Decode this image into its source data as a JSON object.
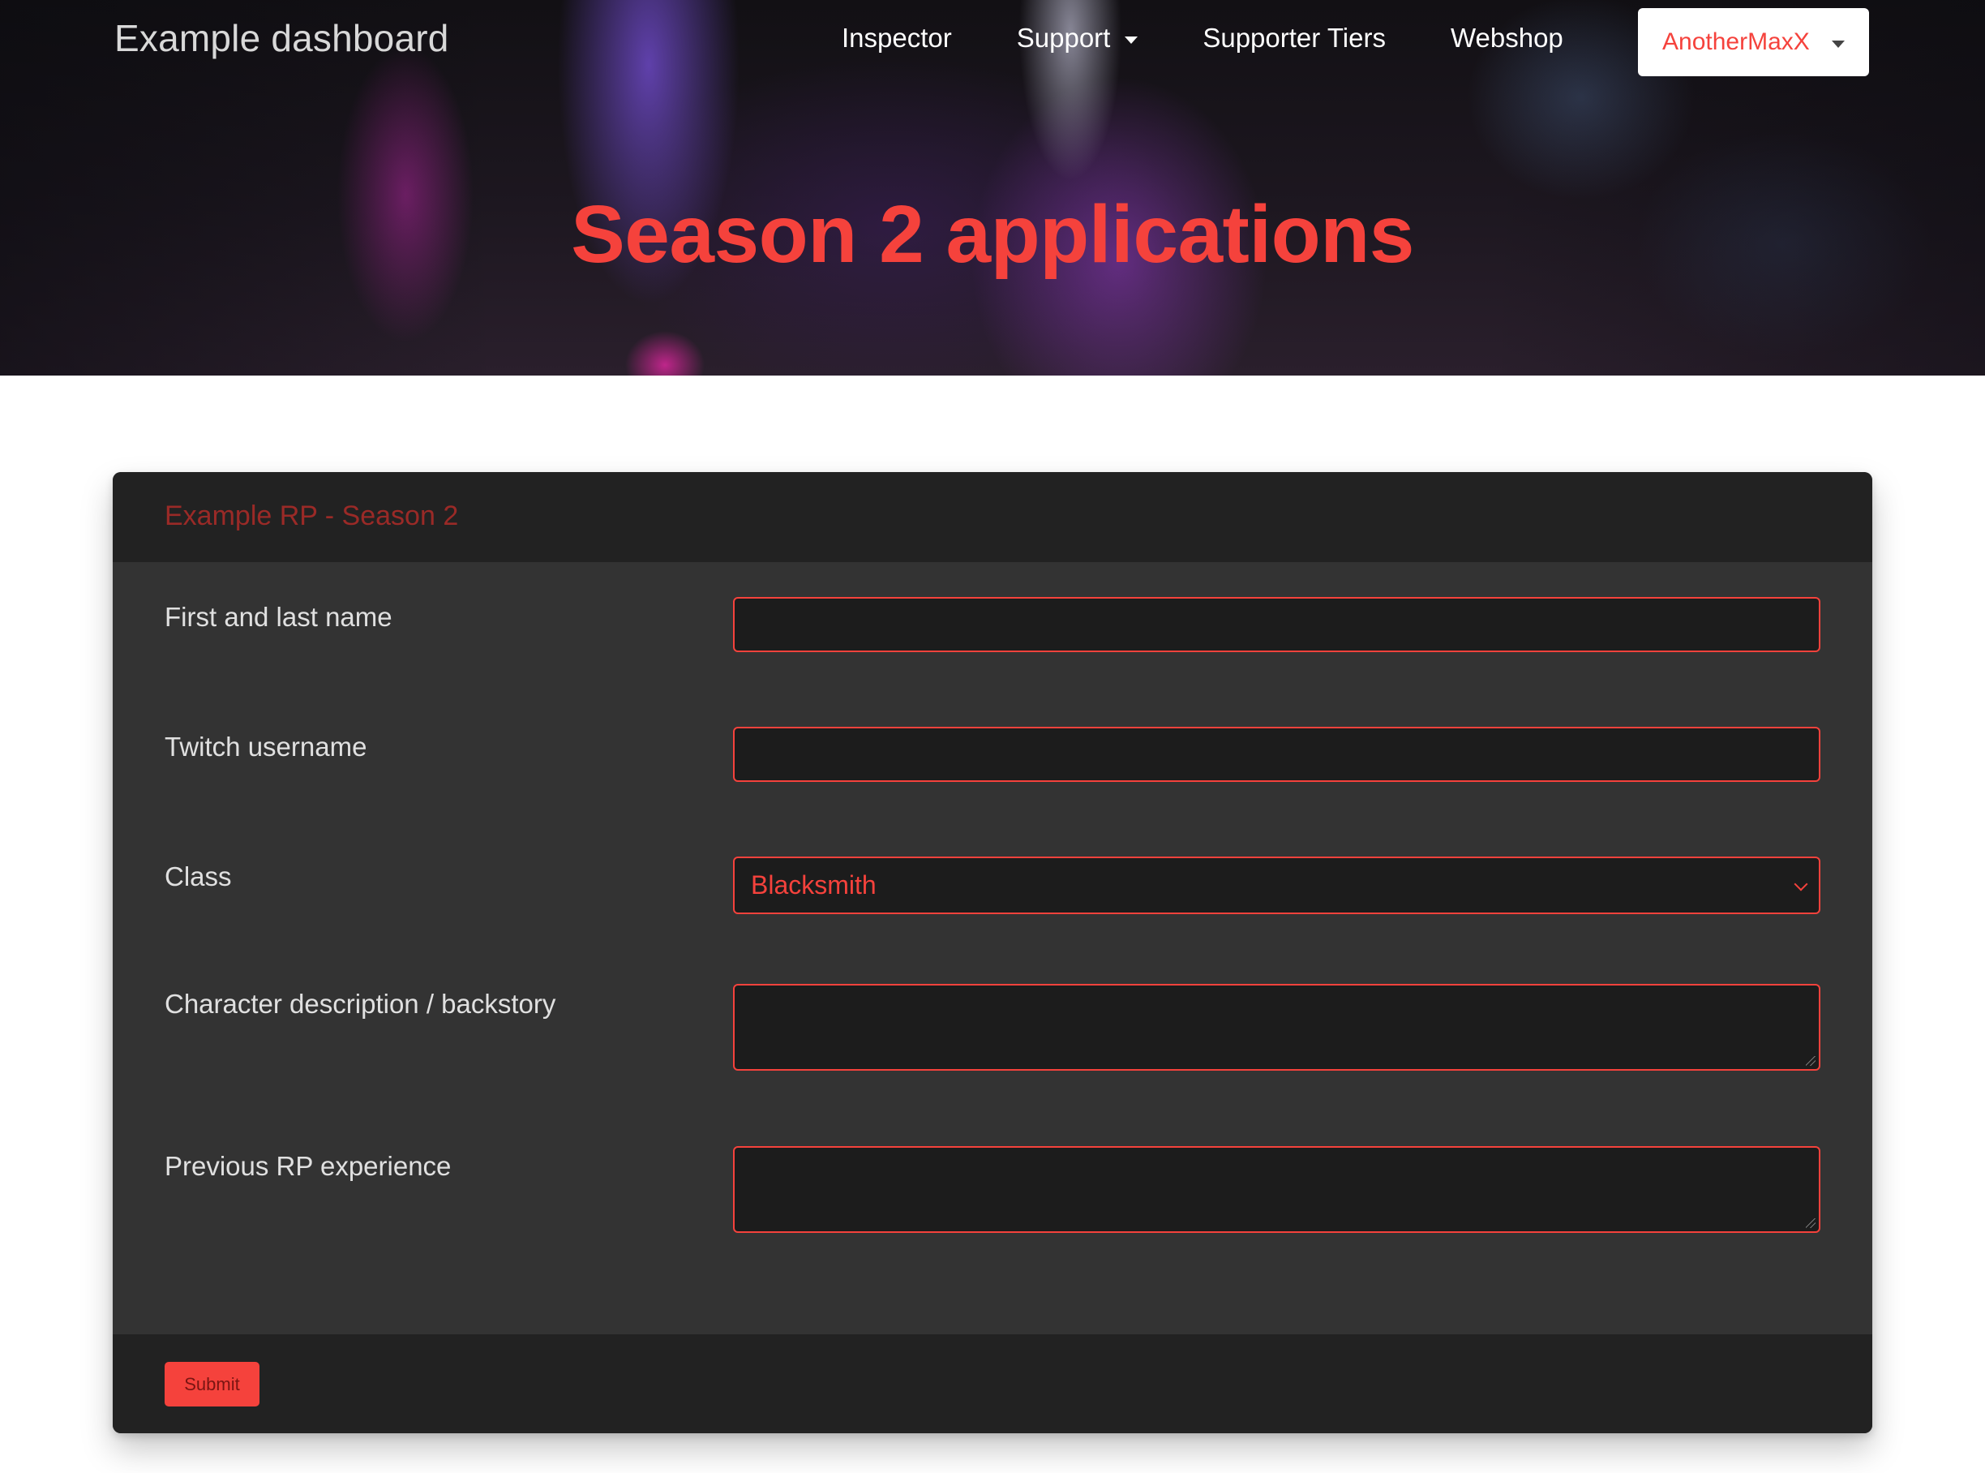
{
  "header": {
    "brand": "Example dashboard",
    "nav": {
      "inspector": "Inspector",
      "support": "Support",
      "supporter_tiers": "Supporter Tiers",
      "webshop": "Webshop"
    },
    "user_menu": "AnotherMaxX"
  },
  "hero": {
    "title": "Season 2 applications"
  },
  "form": {
    "title": "Example RP - Season 2",
    "fields": {
      "name": {
        "label": "First and last name",
        "value": ""
      },
      "twitch": {
        "label": "Twitch username",
        "value": ""
      },
      "class": {
        "label": "Class",
        "selected": "Blacksmith"
      },
      "description": {
        "label": "Character description / backstory",
        "value": ""
      },
      "experience": {
        "label": "Previous RP experience",
        "value": ""
      }
    },
    "submit_label": "Submit"
  },
  "colors": {
    "accent": "#f5423c",
    "card_bg": "#333333",
    "card_header_bg": "#222222",
    "input_bg": "#1c1c1c"
  }
}
